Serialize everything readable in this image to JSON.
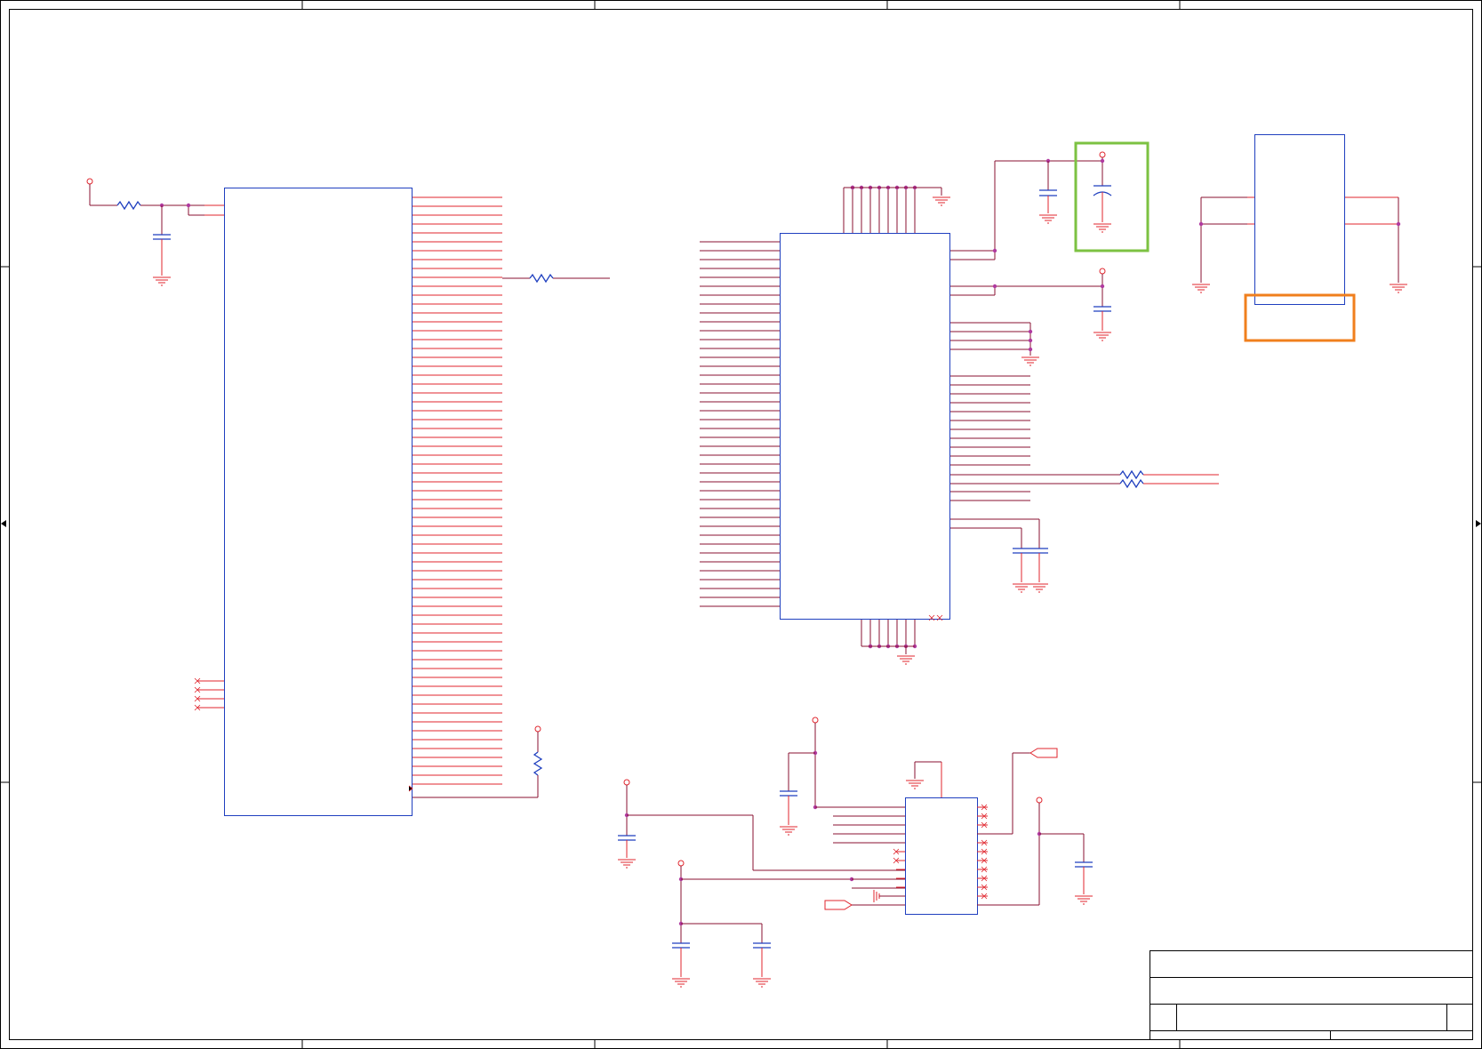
{
  "schematic": {
    "type": "electrical schematic sheet",
    "highlights": [
      {
        "name": "green-box",
        "color": "#7cc242"
      },
      {
        "name": "orange-box",
        "color": "#f07f1d"
      }
    ],
    "colors": {
      "wire": "#8a1030",
      "pin": "#e0262e",
      "component_outline": "#1f3fbf",
      "junction": "#b03aa0",
      "frame": "#000000"
    }
  }
}
